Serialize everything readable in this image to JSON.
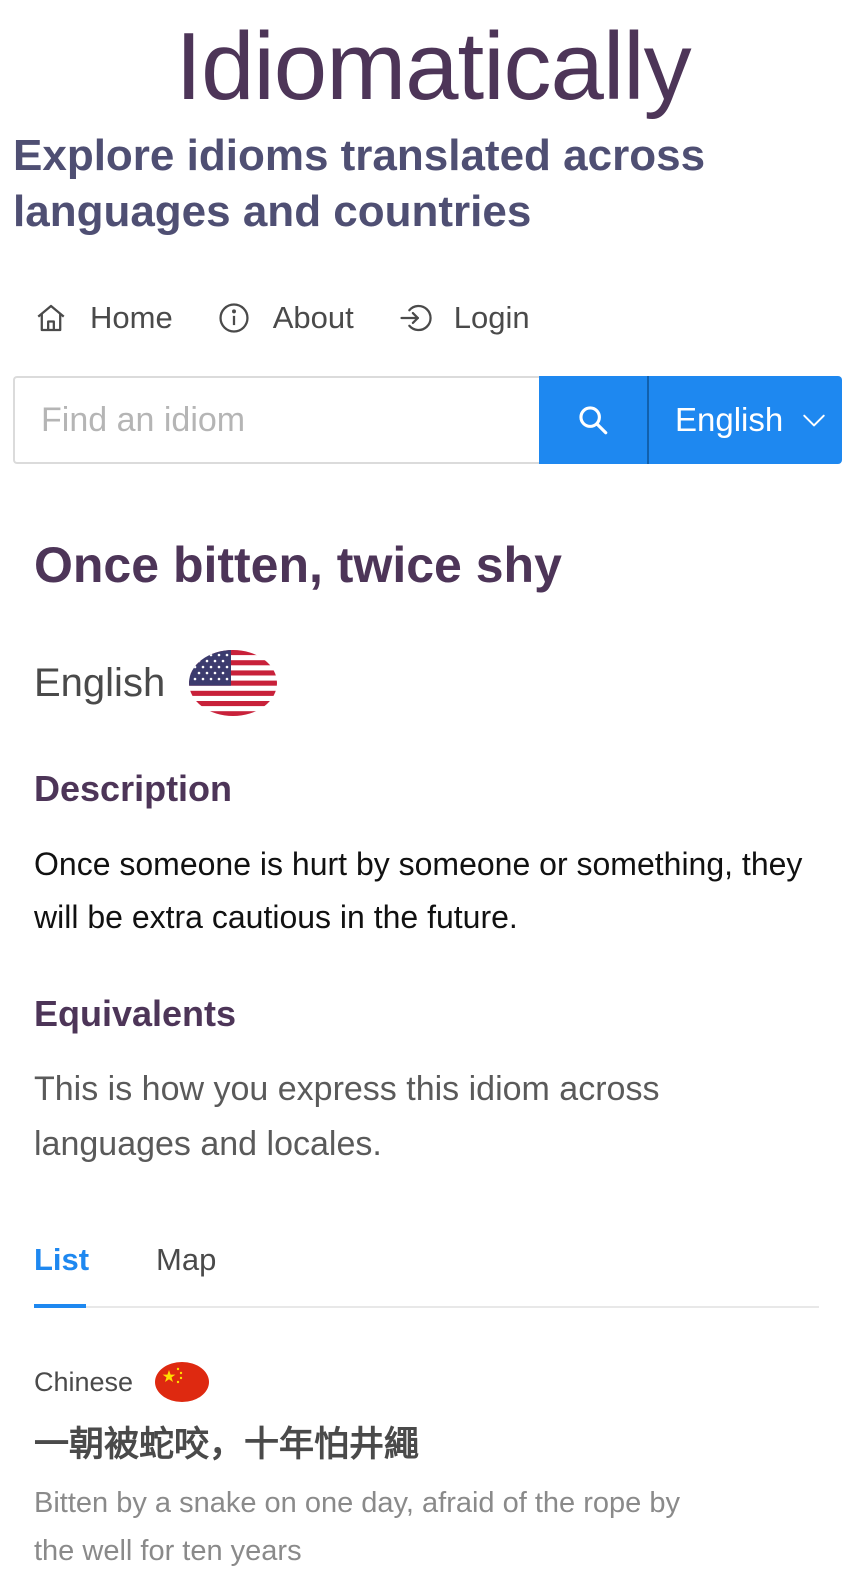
{
  "header": {
    "title": "Idiomatically",
    "tagline": "Explore idioms translated across languages and countries"
  },
  "nav": {
    "items": [
      {
        "label": "Home",
        "icon": "home-icon"
      },
      {
        "label": "About",
        "icon": "info-icon"
      },
      {
        "label": "Login",
        "icon": "login-icon"
      }
    ]
  },
  "search": {
    "placeholder": "Find an idiom",
    "value": "",
    "button_icon": "search-icon",
    "language": "English",
    "language_icon": "chevron-down-icon",
    "accent_color": "#1e88f0"
  },
  "idiom": {
    "title": "Once bitten, twice shy",
    "language": "English",
    "flag": "us-flag",
    "description_heading": "Description",
    "description": "Once someone is hurt by someone or something, they will be extra cautious in the future.",
    "equivalents_heading": "Equivalents",
    "equivalents_intro": "This is how you express this idiom across languages and locales."
  },
  "tabs": {
    "items": [
      "List",
      "Map"
    ],
    "active": "List"
  },
  "equivalents": [
    {
      "language": "Chinese",
      "flag": "cn-flag",
      "phrase": "一朝被蛇咬，十年怕井繩",
      "translation": "Bitten by a snake on one day, afraid of the rope by the well for ten years"
    }
  ],
  "colors": {
    "title": "#4d3558",
    "tagline": "#4f4f73",
    "accent": "#1e88f0"
  }
}
